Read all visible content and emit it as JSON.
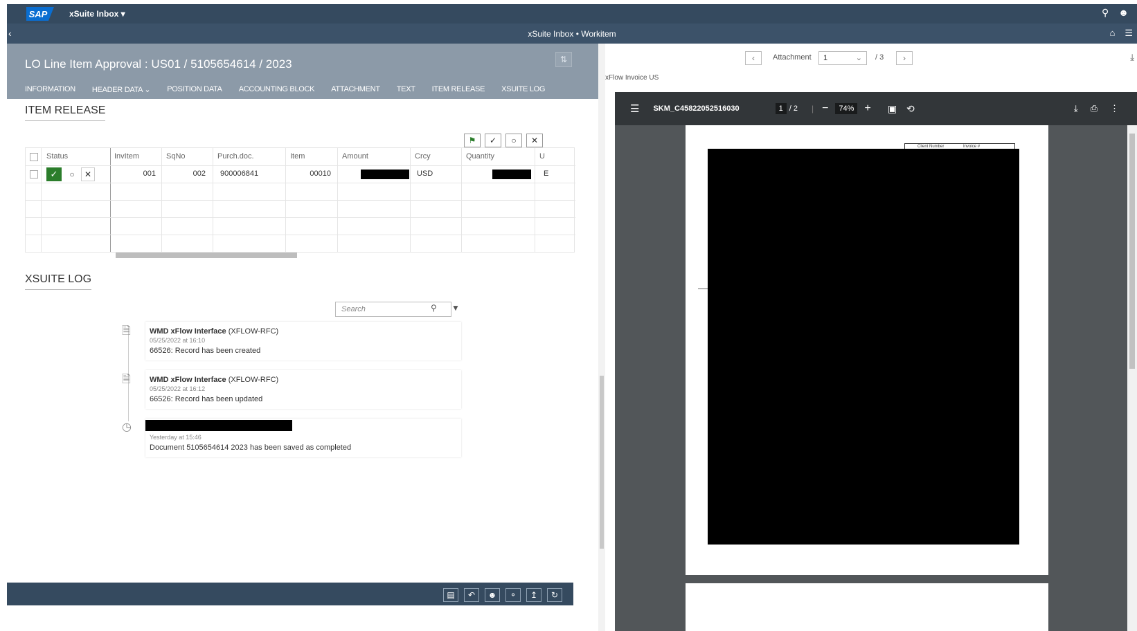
{
  "shell": {
    "logo": "SAP",
    "app_title": "xSuite Inbox ▾",
    "search_icon": "search-icon",
    "user_icon": "user-icon"
  },
  "subheader": {
    "title": "xSuite Inbox • Workitem"
  },
  "object": {
    "title": "LO Line Item Approval : US01 / 5105654614 / 2023",
    "tabs": [
      "INFORMATION",
      "HEADER DATA ⌄",
      "POSITION DATA",
      "ACCOUNTING BLOCK",
      "ATTACHMENT",
      "TEXT",
      "ITEM RELEASE",
      "XSUITE LOG"
    ]
  },
  "item_release": {
    "title": "ITEM RELEASE",
    "columns": [
      "Status",
      "InvItem",
      "SqNo",
      "Purch.doc.",
      "Item",
      "Amount",
      "Crcy",
      "Quantity",
      "U"
    ],
    "rows": [
      {
        "invitem": "001",
        "sqno": "002",
        "purch_doc": "900006841",
        "item": "00010",
        "crcy": "USD",
        "unit": "E"
      }
    ]
  },
  "xsuite_log": {
    "title": "XSUITE LOG",
    "search_placeholder": "Search",
    "entries": [
      {
        "who": "WMD xFlow Interface",
        "system": "(XFLOW-RFC)",
        "when": "05/25/2022 at 16:10",
        "msg": "66526: Record has been created"
      },
      {
        "who": "WMD xFlow Interface",
        "system": "(XFLOW-RFC)",
        "when": "05/25/2022 at 16:12",
        "msg": "66526: Record has been updated"
      },
      {
        "who": "",
        "system": "",
        "when": "Yesterday at 15:46",
        "msg": "Document 5105654614 2023 has been saved as completed"
      }
    ]
  },
  "attachment": {
    "label": "Attachment",
    "current": "1",
    "total": "/ 3",
    "doc_label": "xFlow Invoice US"
  },
  "pdf": {
    "filename": "SKM_C45822052516030",
    "page_current": "1",
    "page_total": "/  2",
    "zoom": "74%",
    "page_header_1": "Client Number",
    "page_header_2": "Invoice #"
  },
  "colors": {
    "shell": "#354a5f",
    "object_header": "#8c9aa8",
    "accent_green": "#2b7d2b"
  }
}
